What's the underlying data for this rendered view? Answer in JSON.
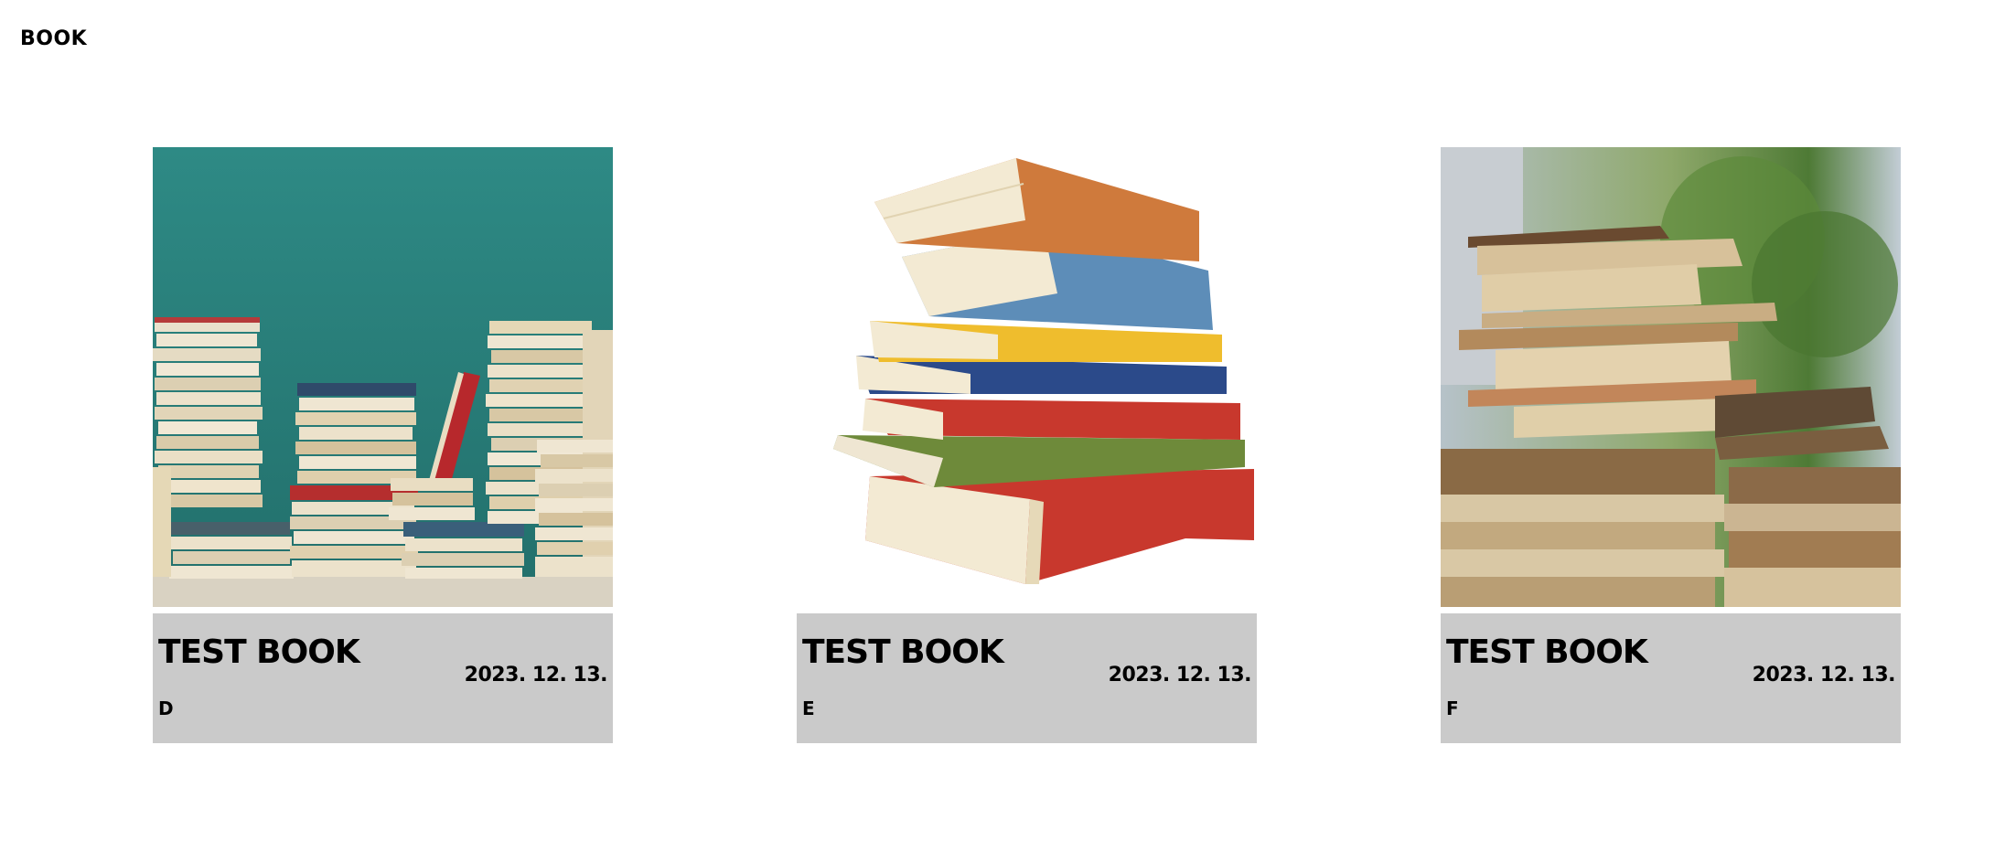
{
  "header": {
    "title": "BOOK"
  },
  "books": [
    {
      "title": "TEST BOOK",
      "date": "2023. 12. 13.",
      "author": "D"
    },
    {
      "title": "TEST BOOK",
      "date": "2023. 12. 13.",
      "author": "E"
    },
    {
      "title": "TEST BOOK",
      "date": "2023. 12. 13.",
      "author": "F"
    }
  ]
}
